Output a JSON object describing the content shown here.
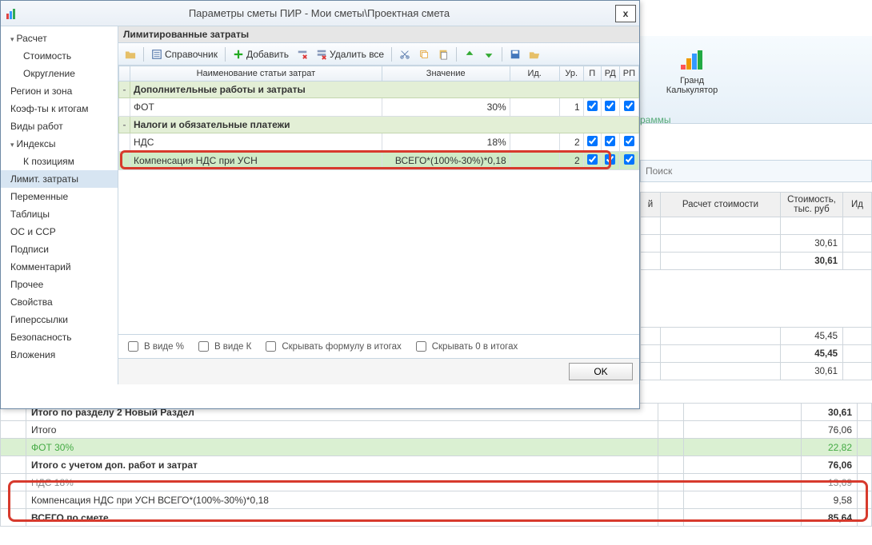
{
  "dialog": {
    "title": "Параметры сметы ПИР - Мои сметы\\Проектная смета",
    "close": "x",
    "subtitle": "Лимитированные затраты",
    "toolbar": {
      "ref": "Справочник",
      "add": "Добавить",
      "delAll": "Удалить все"
    },
    "tree": [
      {
        "l": "Расчет",
        "lvl": "p1",
        "car": true
      },
      {
        "l": "Стоимость",
        "lvl": "p2"
      },
      {
        "l": "Округление",
        "lvl": "p2"
      },
      {
        "l": "Регион и зона",
        "lvl": "p1"
      },
      {
        "l": "Коэф-ты к итогам",
        "lvl": "p1"
      },
      {
        "l": "Виды работ",
        "lvl": "p1"
      },
      {
        "l": "Индексы",
        "lvl": "p1",
        "car": true
      },
      {
        "l": "К позициям",
        "lvl": "p2"
      },
      {
        "l": "Лимит. затраты",
        "lvl": "p1",
        "sel": true
      },
      {
        "l": "Переменные",
        "lvl": "p1"
      },
      {
        "l": "Таблицы",
        "lvl": "p1"
      },
      {
        "l": "ОС и ССР",
        "lvl": "p1"
      },
      {
        "l": "Подписи",
        "lvl": "p1"
      },
      {
        "l": "Комментарий",
        "lvl": "p1"
      },
      {
        "l": "Прочее",
        "lvl": "p1"
      },
      {
        "l": "Свойства",
        "lvl": "p1"
      },
      {
        "l": "Гиперссылки",
        "lvl": "p1"
      },
      {
        "l": "Безопасность",
        "lvl": "p1"
      },
      {
        "l": "Вложения",
        "lvl": "p1"
      }
    ],
    "cols": {
      "name": "Наименование статьи затрат",
      "val": "Значение",
      "id": "Ид.",
      "ur": "Ур.",
      "p": "П",
      "rd": "РД",
      "rp": "РП"
    },
    "rows": [
      {
        "t": "grp",
        "ex": "-",
        "name": "Дополнительные работы и затраты"
      },
      {
        "t": "row",
        "name": "ФОТ",
        "val": "30%",
        "ur": "1",
        "p": true,
        "rd": true,
        "rp": true
      },
      {
        "t": "grp",
        "ex": "-",
        "name": "Налоги и обязательные платежи"
      },
      {
        "t": "row",
        "name": "НДС",
        "val": "18%",
        "ur": "2",
        "p": true,
        "rd": true,
        "rp": true
      },
      {
        "t": "row",
        "sel": true,
        "name": "Компенсация НДС при УСН",
        "val": "ВСЕГО*(100%-30%)*0,18",
        "ur": "2",
        "p": true,
        "rd": true,
        "rp": true
      }
    ],
    "opts": {
      "pct": "В виде %",
      "k": "В виде К",
      "hideF": "Скрывать формулу в итогах",
      "hide0": "Скрывать 0 в итогах"
    },
    "ok": "OK"
  },
  "ribbon": {
    "calc1": "Гранд",
    "calc2": "Калькулятор",
    "prog": "раммы",
    "search": "Поиск"
  },
  "rightCols": {
    "c0": "й",
    "c1": "Расчет стоимости",
    "c2": "Стоимость, тыс. руб",
    "c3": "Ид"
  },
  "rightVals": {
    "a": "30,61",
    "b": "30,61",
    "c": "45,45",
    "d": "45,45",
    "e": "30,61",
    "f": "30,61"
  },
  "bottom": [
    {
      "name": "Итого по разделу 2 Новый Раздел",
      "v": "30,61",
      "b": true
    },
    {
      "name": "Итого",
      "v": "76,06"
    },
    {
      "name": "ФОТ 30%",
      "v": "22,82",
      "g": true
    },
    {
      "name": "Итого с учетом доп. работ и затрат",
      "v": "76,06",
      "b": true
    },
    {
      "name": "НДС 18%",
      "v": "13,69",
      "m": true
    },
    {
      "name": "Компенсация НДС при УСН ВСЕГО*(100%-30%)*0,18",
      "v": "9,58"
    },
    {
      "name": "ВСЕГО по смете",
      "v": "85,64",
      "b": true
    }
  ]
}
